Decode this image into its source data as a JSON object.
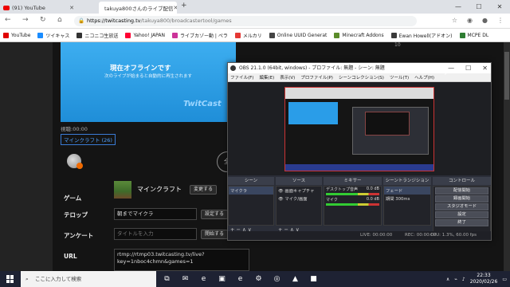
{
  "browser": {
    "tabs": [
      {
        "title": "(91) YouTube",
        "active": false
      },
      {
        "title": "takuya800さんのライブ配信",
        "active": true
      }
    ],
    "new_tab": "+",
    "window_buttons": [
      "—",
      "☐",
      "✕"
    ],
    "url_host": "https://twitcasting.tv",
    "url_path": "/takuya800/broadcastertool/games",
    "bookmarks": [
      "YouTube",
      "ツイキャス",
      "ニコニコ生放送",
      "Yahoo! JAPAN",
      "ライブカゾー動 | ペラ",
      "メルカリ",
      "Online UUID Generat",
      "Minecraft Addons",
      "Ewan Howell(アドオン)",
      "MCPE DL"
    ],
    "bookmark_colors": [
      "#e00000",
      "#1a8cff",
      "#333333",
      "#ff0033",
      "#cc3399",
      "#e53935",
      "#444444",
      "#5b8c2a",
      "#3a3a3a",
      "#2e7d32"
    ]
  },
  "page": {
    "offline_title": "現在オフラインです",
    "offline_sub": "次のライブが始まると自動的に再生されます",
    "brand": "TwitCast",
    "viewer_time": "視聴:00:00",
    "category_tag": "マインクラフト (26)",
    "round_btn": "全",
    "right_num": "10",
    "game_label": "ゲーム",
    "game_name": "マインクラフト",
    "change_btn": "変更する",
    "telop_label": "テロップ",
    "telop_value": "朝までマイクラ",
    "set_btn": "設定する",
    "survey_label": "アンケート",
    "survey_placeholder": "タイトルを入力",
    "start_btn": "開始する",
    "url_label": "URL",
    "url_line1": "rtmp://rtmp03.twitcasting.tv/live?",
    "url_line2": "key=1nboc4chmn&games=1"
  },
  "obs": {
    "title": "OBS 21.1.0 (64bit, windows) - プロファイル: 無題 - シーン: 無題",
    "window_buttons": [
      "—",
      "☐",
      "✕"
    ],
    "menu": [
      "ファイル(F)",
      "編集(E)",
      "表示(V)",
      "プロファイル(P)",
      "シーンコレクション(S)",
      "ツール(T)",
      "ヘルプ(H)"
    ],
    "panels": {
      "scenes_header": "シーン",
      "sources_header": "ソース",
      "mixer_header": "ミキサー",
      "transitions_header": "シーントランジション",
      "controls_header": "コントロール"
    },
    "scenes": [
      "マイクラ"
    ],
    "sources": [
      "画面キャプチャ",
      "マイク/画面"
    ],
    "mixer": [
      {
        "name": "デスクトップ音声",
        "db": "0.0 dB"
      },
      {
        "name": "マイク",
        "db": "0.0 dB"
      }
    ],
    "transition": "フェード",
    "duration_label": "期間",
    "duration_value": "300ms",
    "controls": [
      "配信開始",
      "録画開始",
      "スタジオモード",
      "設定",
      "終了"
    ],
    "panel_footer": "+  −  ∧  ∨",
    "status_live": "LIVE: 00:00:00",
    "status_rec": "REC: 00:00:00",
    "status_cpu": "CPU: 1.3%, 60.00 fps"
  },
  "taskbar": {
    "search_placeholder": "ここに入力して検索",
    "time": "22:33",
    "date": "2020/02/26",
    "app_icons": [
      "⧉",
      "✉",
      "e",
      "▣",
      "e",
      "⚙",
      "◎",
      "▲",
      "■"
    ]
  }
}
